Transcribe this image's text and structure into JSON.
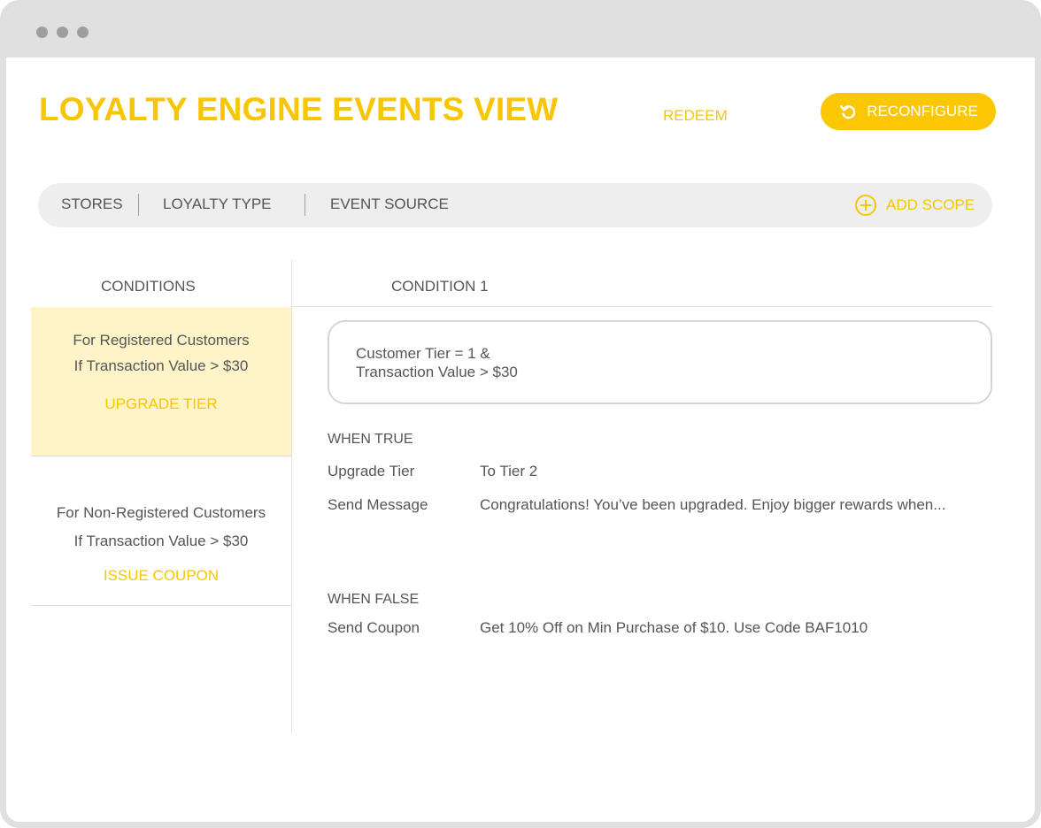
{
  "header": {
    "title": "LOYALTY ENGINE EVENTS VIEW",
    "redeem_label": "REDEEM",
    "reconfigure_label": "RECONFIGURE"
  },
  "scope_bar": {
    "items": [
      "STORES",
      "LOYALTY TYPE",
      "EVENT SOURCE"
    ],
    "add_scope_label": "ADD SCOPE"
  },
  "conditions_panel": {
    "heading": "CONDITIONS",
    "items": [
      {
        "line1": "For Registered Customers",
        "line2": "If Transaction Value > $30",
        "action": "UPGRADE TIER",
        "selected": true
      },
      {
        "line1": "For Non-Registered Customers",
        "line2": "If Transaction Value > $30",
        "action": "ISSUE COUPON",
        "selected": false
      }
    ]
  },
  "detail": {
    "heading": "CONDITION 1",
    "expression_line1": "Customer Tier = 1 &",
    "expression_line2": "Transaction Value > $30",
    "when_true_label": "WHEN TRUE",
    "when_true_rows": [
      {
        "key": "Upgrade Tier",
        "value": "To Tier 2"
      },
      {
        "key": "Send Message",
        "value": "Congratulations! You’ve been upgraded. Enjoy bigger rewards when..."
      }
    ],
    "when_false_label": "WHEN FALSE",
    "when_false_rows": [
      {
        "key": "Send Coupon",
        "value": "Get 10% Off on Min Purchase of $10. Use Code BAF1010"
      }
    ]
  },
  "colors": {
    "accent": "#f7c600",
    "button": "#fbc700",
    "selected_bg": "#fff3c8",
    "text": "#555555",
    "frame": "#e0e0e0"
  },
  "icons": {
    "reconfigure": "refresh-icon",
    "add_scope": "plus-circle-icon"
  }
}
